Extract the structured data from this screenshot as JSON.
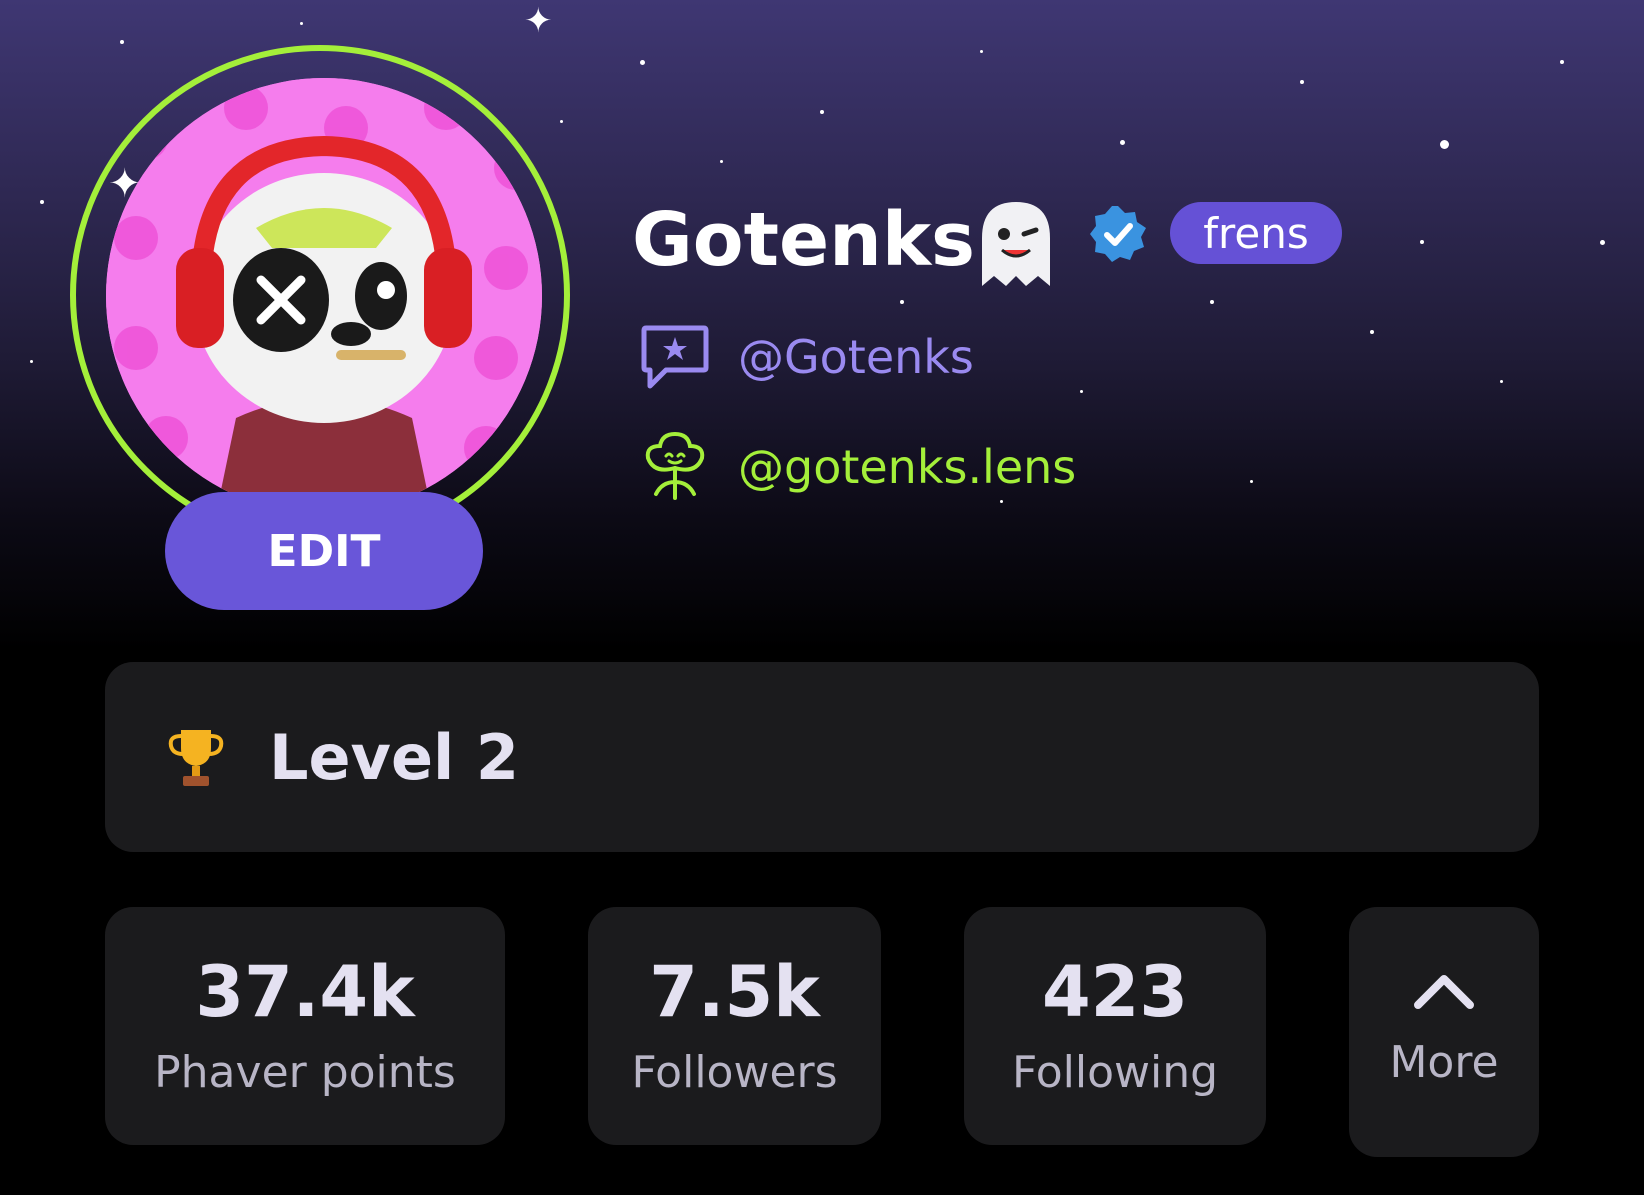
{
  "profile": {
    "display_name": "Gotenks",
    "name_emoji": "👻",
    "badge_label": "frens",
    "phaver_handle": "@Gotenks",
    "lens_handle": "@gotenks.lens",
    "edit_label": "EDIT"
  },
  "level": {
    "label": "Level 2",
    "icon": "trophy-icon"
  },
  "stats": [
    {
      "value": "37.4k",
      "label": "Phaver points"
    },
    {
      "value": "7.5k",
      "label": "Followers"
    },
    {
      "value": "423",
      "label": "Following"
    }
  ],
  "more": {
    "label": "More",
    "icon": "chevron-up-icon"
  },
  "colors": {
    "accent_purple": "#6956d9",
    "lens_green": "#a4ef3a",
    "handle_purple": "#9a8af0",
    "card_bg": "#1b1b1d",
    "avatar_bg": "#f57ded",
    "verified_blue": "#3a93e0"
  }
}
